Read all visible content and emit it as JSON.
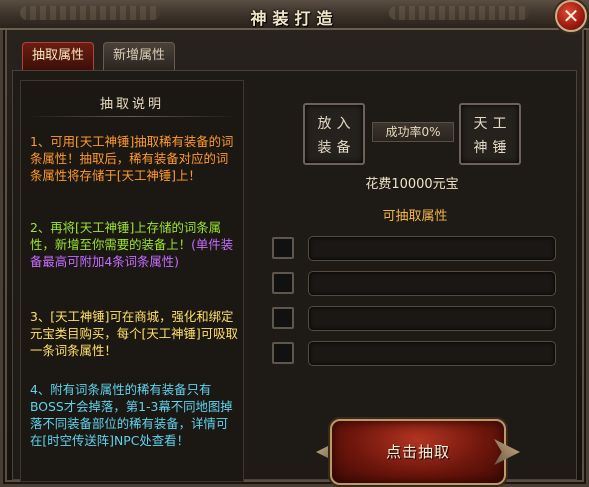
{
  "window": {
    "title": "神装打造",
    "close_glyph": "✕"
  },
  "tabs": [
    {
      "label": "抽取属性",
      "active": true
    },
    {
      "label": "新增属性",
      "active": false
    }
  ],
  "explanation": {
    "title": "抽取说明",
    "p1": "1、可用[天工神锤]抽取稀有装备的词条属性！抽取后，稀有装备对应的词条属性将存储于[天工神锤]上！",
    "p2_main": "2、再将[天工神锤]上存储的词条属性，新增至你需要的装备上！",
    "p2_sub": "(单件装备最高可附加4条词条属性)",
    "p3": "3、[天工神锤]可在商城，强化和绑定元宝类目购买，每个[天工神锤]可吸取一条词条属性！",
    "p4": "4、附有词条属性的稀有装备只有BOSS才会掉落，第1-3幕不同地图掉落不同装备部位的稀有装备，详情可在[时空传送阵]NPC处查看！"
  },
  "craft": {
    "equip_slot": "放入装备",
    "hammer_slot": "天工神锤",
    "success_rate": "成功率0%",
    "cost": "花费10000元宝"
  },
  "attributes": {
    "title": "可抽取属性",
    "rows": [
      "",
      "",
      "",
      ""
    ]
  },
  "actions": {
    "extract_label": "点击抽取"
  },
  "colors": {
    "p1": "#ff9a2e",
    "p2": "#9be532",
    "p2_sub": "#c76cff",
    "p3": "#ffe066",
    "p4": "#5fd3ee",
    "attr_title": "#f0b54a"
  }
}
